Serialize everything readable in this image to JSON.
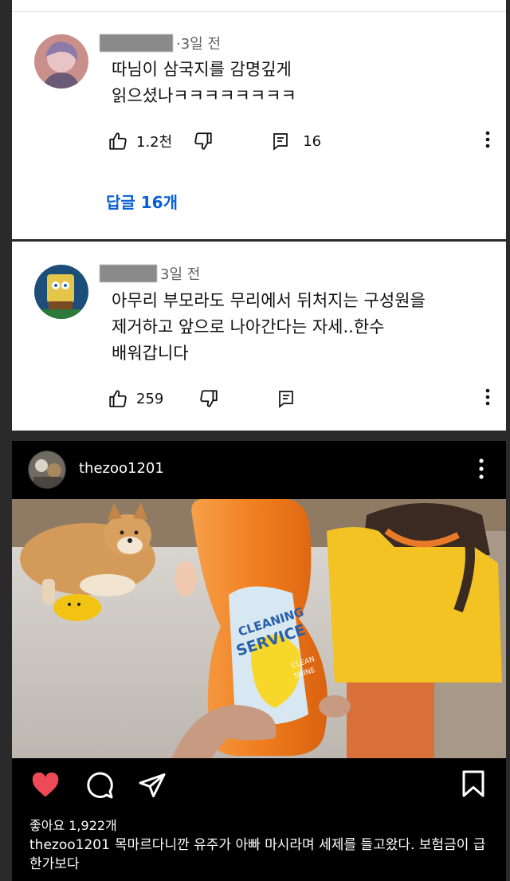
{
  "comments": [
    {
      "time": "·3일 전",
      "text_line1": "따님이 삼국지를 감명깊게",
      "text_line2": "읽으셨나ㅋㅋㅋㅋㅋㅋㅋㅋ",
      "likes": "1.2천",
      "replies_count": "16",
      "replies_link": "답글 16개"
    },
    {
      "time": "3일 전",
      "text_line1": "아무리 부모라도 무리에서 뒤처지는 구성원을",
      "text_line2": "제거하고 앞으로 나아간다는 자세..한수",
      "text_line3": "배워갑니다",
      "likes": "259"
    }
  ],
  "instagram": {
    "username": "thezoo1201",
    "likes": "좋아요 1,922개",
    "caption_user": "thezoo1201",
    "caption_text": "목마르다니깐 유주가 아빠 마시라며 세제를 들고왔다. 보험금이 급한가보다",
    "bottle_text1": "CLEANING",
    "bottle_text2": "SERVICE",
    "bottle_text3": "CLEAN",
    "bottle_text4": "SHINE"
  },
  "colors": {
    "link_blue": "#065fd4",
    "like_red": "#ed4956",
    "bottle_orange": "#f07d1e"
  }
}
